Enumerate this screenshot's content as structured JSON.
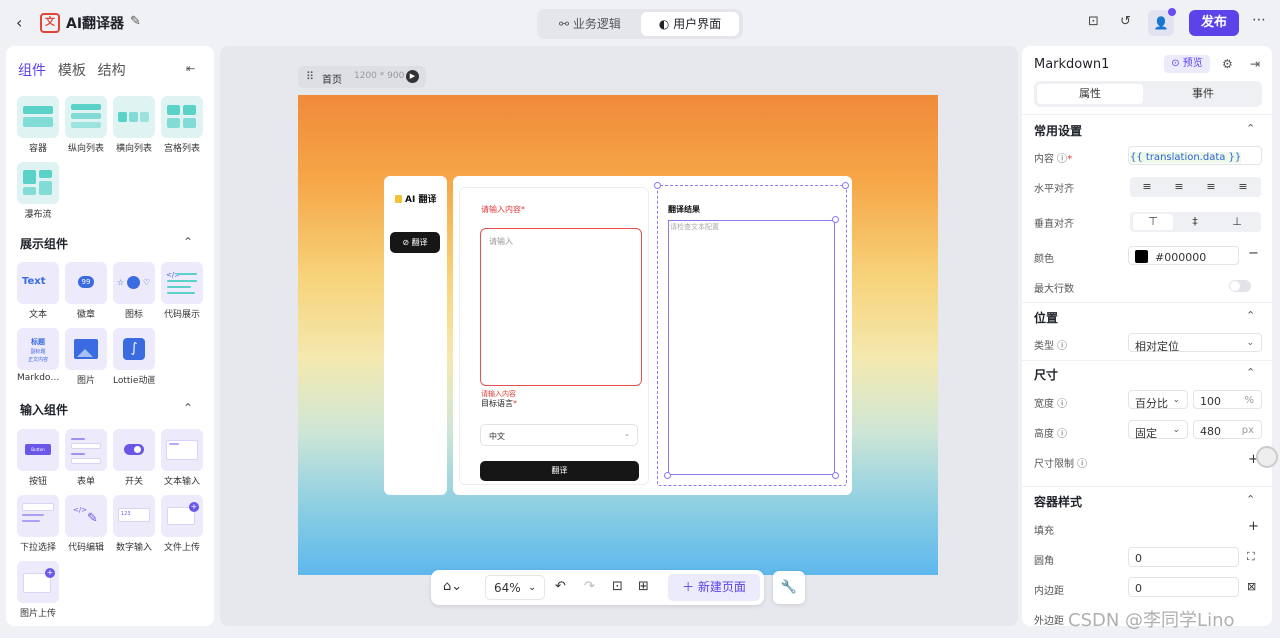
{
  "header": {
    "app_title": "AI翻译器",
    "tabs": [
      "业务逻辑",
      "用户界面"
    ],
    "publish_label": "发布"
  },
  "left_panel": {
    "tabs": [
      "组件",
      "模板",
      "结构"
    ],
    "layout_items": [
      "容器",
      "纵向列表",
      "横向列表",
      "宫格列表",
      "瀑布流"
    ],
    "display_section": "展示组件",
    "display_items": [
      "文本",
      "徽章",
      "图标",
      "代码展示",
      "Markdo…",
      "图片",
      "Lottie动画"
    ],
    "input_section": "输入组件",
    "input_items": [
      "按钮",
      "表单",
      "开关",
      "文本输入",
      "下拉选择",
      "代码编辑",
      "数字输入",
      "文件上传",
      "图片上传"
    ],
    "thumb_text": {
      "text": "Text",
      "badge": "99",
      "button": "Button",
      "md": [
        "标题",
        "副标题",
        "正文内容"
      ],
      "num": "123"
    }
  },
  "canvas": {
    "page_name": "首页",
    "page_size": "1200 * 900",
    "preview": {
      "brand": "AI 翻译",
      "nav_button": "翻译",
      "input_label": "请输入内容",
      "input_placeholder": "请输入",
      "input_error": "请输入内容",
      "lang_label": "目标语言",
      "lang_value": "中文",
      "translate_button": "翻译",
      "result_title": "翻译结果",
      "result_placeholder": "请检查文本配置"
    }
  },
  "bottom_toolbar": {
    "zoom": "64%",
    "new_page": "新建页面"
  },
  "right_panel": {
    "component_name": "Markdown1",
    "preview_label": "预览",
    "tabs": [
      "属性",
      "事件"
    ],
    "common_section": "常用设置",
    "content_label": "内容",
    "content_value": "{{ translation.data }}",
    "halign_label": "水平对齐",
    "valign_label": "垂直对齐",
    "color_label": "颜色",
    "color_value": "#000000",
    "maxlines_label": "最大行数",
    "position_section": "位置",
    "type_label": "类型",
    "type_value": "相对定位",
    "size_section": "尺寸",
    "width_label": "宽度",
    "width_mode": "百分比",
    "width_value": "100",
    "width_unit": "%",
    "height_label": "高度",
    "height_mode": "固定",
    "height_value": "480",
    "height_unit": "px",
    "size_limit_label": "尺寸限制",
    "container_section": "容器样式",
    "fill_label": "填充",
    "radius_label": "圆角",
    "radius_value": "0",
    "padding_label": "内边距",
    "padding_value": "0",
    "margin_label": "外边距"
  },
  "watermark": "CSDN @李同学Lino",
  "colors": {
    "accent": "#5b43ea",
    "error": "#e03a3a"
  }
}
